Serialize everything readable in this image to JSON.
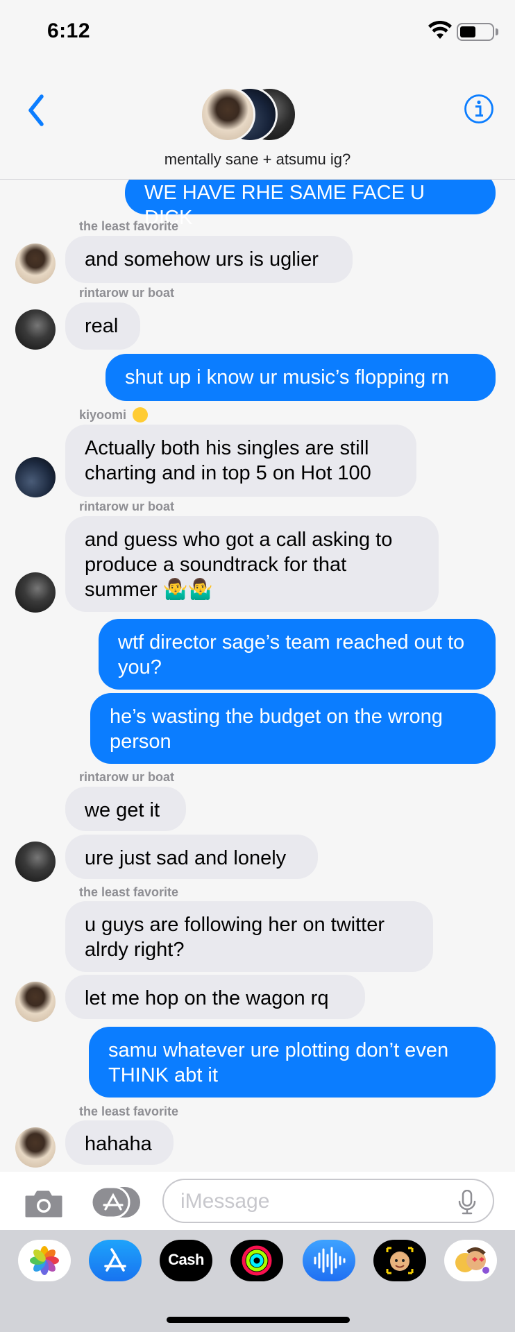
{
  "status_bar": {
    "time": "6:12"
  },
  "header": {
    "group_name": "mentally sane + atsumu ig?"
  },
  "colors": {
    "sent_bubble": "#0b7dff",
    "received_bubble": "#e9e9ee",
    "accent": "#0b7dff"
  },
  "messages": [
    {
      "type": "sent",
      "text": "WE HAVE RHE SAME FACE U DICK"
    },
    {
      "type": "sender",
      "text": "the least favorite"
    },
    {
      "type": "received",
      "text": "and somehow urs is uglier",
      "avatar": "the least favorite"
    },
    {
      "type": "sender",
      "text": "rintarow ur boat"
    },
    {
      "type": "received",
      "text": "real",
      "avatar": "rintarow ur boat"
    },
    {
      "type": "sent",
      "text": "shut up i know ur music’s flopping rn"
    },
    {
      "type": "sender",
      "text": "kiyoomi",
      "emoji": "zany-face-emoji"
    },
    {
      "type": "received",
      "text": "Actually both his singles are still charting and in top 5 on Hot 100",
      "avatar": "kiyoomi"
    },
    {
      "type": "sender",
      "text": "rintarow ur boat"
    },
    {
      "type": "received",
      "text": "and guess who got a call asking to produce a soundtrack for that summer 🤷‍♂️🤷‍♂️",
      "avatar": "rintarow ur boat"
    },
    {
      "type": "sent",
      "text": "wtf director sage’s team reached out to you?"
    },
    {
      "type": "sent",
      "text": "he’s wasting the budget on the wrong person"
    },
    {
      "type": "sender",
      "text": "rintarow ur boat"
    },
    {
      "type": "received",
      "text": "we get it"
    },
    {
      "type": "received",
      "text": "ure just sad and lonely",
      "avatar": "rintarow ur boat"
    },
    {
      "type": "sender",
      "text": "the least favorite"
    },
    {
      "type": "received",
      "text": "u guys are following her on twitter alrdy right?"
    },
    {
      "type": "received",
      "text": "let me hop on the wagon rq",
      "avatar": "the least favorite"
    },
    {
      "type": "sent",
      "text": "samu whatever ure plotting don’t even THINK abt it"
    },
    {
      "type": "sender",
      "text": "the least favorite"
    },
    {
      "type": "received",
      "text": "hahaha",
      "avatar": "the least favorite"
    }
  ],
  "input": {
    "placeholder": "iMessage"
  },
  "app_drawer": {
    "apps": [
      "photos-icon",
      "app-store-icon",
      "apple-cash-icon",
      "activity-icon",
      "voice-memo-icon",
      "memoji-icon",
      "memoji-stickers-icon"
    ],
    "cash_label": "Cash"
  }
}
